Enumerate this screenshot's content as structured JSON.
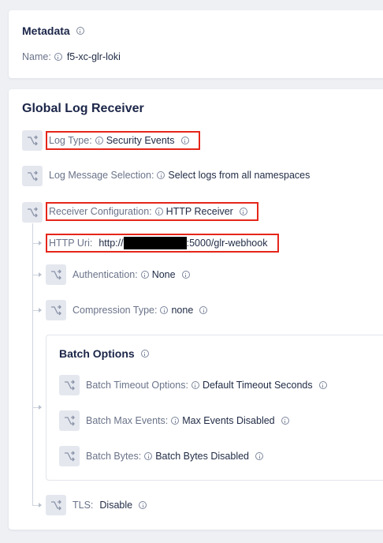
{
  "metadata": {
    "title": "Metadata",
    "name_label": "Name:",
    "name_value": "f5-xc-glr-loki"
  },
  "glr": {
    "title": "Global Log Receiver",
    "log_type": {
      "label": "Log Type:",
      "value": "Security Events"
    },
    "log_message_selection": {
      "label": "Log Message Selection:",
      "value": "Select logs from all namespaces"
    },
    "receiver_configuration": {
      "label": "Receiver Configuration:",
      "value": "HTTP Receiver"
    },
    "http_uri": {
      "label": "HTTP Uri:",
      "value_prefix": "http://",
      "value_suffix": ":5000/glr-webhook"
    },
    "authentication": {
      "label": "Authentication:",
      "value": "None"
    },
    "compression_type": {
      "label": "Compression Type:",
      "value": "none"
    },
    "batch_options": {
      "title": "Batch Options",
      "timeout": {
        "label": "Batch Timeout Options:",
        "value": "Default Timeout Seconds"
      },
      "max_events": {
        "label": "Batch Max Events:",
        "value": "Max Events Disabled"
      },
      "bytes": {
        "label": "Batch Bytes:",
        "value": "Batch Bytes Disabled"
      }
    },
    "tls": {
      "label": "TLS:",
      "value": "Disable"
    }
  },
  "colors": {
    "highlight": "#e5261a",
    "background": "#eef0f4",
    "card": "#ffffff",
    "label": "#6a7389",
    "value": "#1f2a44"
  },
  "icons": [
    "info-icon",
    "flow-icon"
  ]
}
